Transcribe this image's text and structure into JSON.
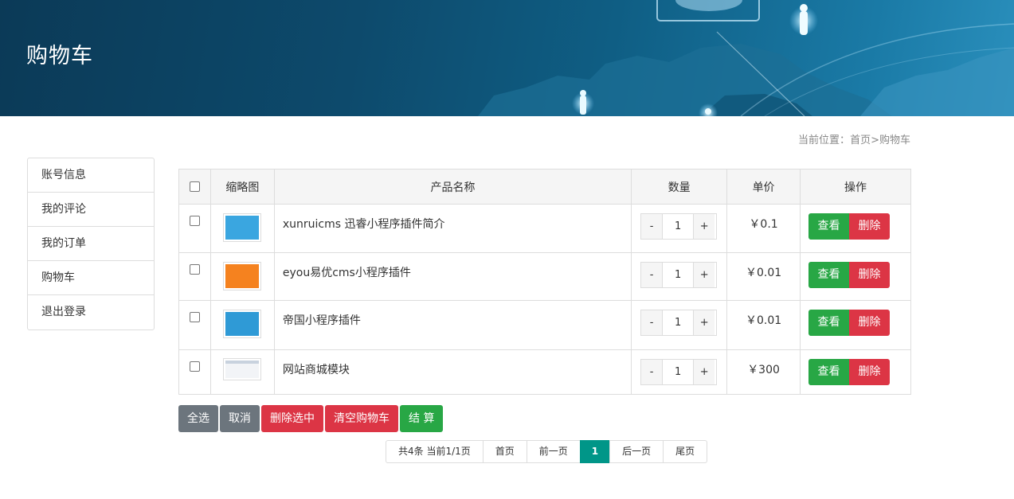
{
  "header": {
    "title": "购物车"
  },
  "breadcrumb": {
    "prefix": "当前位置：",
    "home": "首页",
    "separator": ">",
    "current": "购物车"
  },
  "sidebar": {
    "items": [
      {
        "label": "账号信息"
      },
      {
        "label": "我的评论"
      },
      {
        "label": "我的订单"
      },
      {
        "label": "购物车"
      },
      {
        "label": "退出登录"
      }
    ]
  },
  "table": {
    "headers": {
      "thumb": "缩略图",
      "name": "产品名称",
      "qty": "数量",
      "price": "单价",
      "op": "操作"
    },
    "rows": [
      {
        "name": "xunruicms 迅睿小程序插件简介",
        "qty": "1",
        "price": "￥0.1",
        "thumb_color": "#3aa6e0"
      },
      {
        "name": "eyou易优cms小程序插件",
        "qty": "1",
        "price": "￥0.01",
        "thumb_color": "#f5821f"
      },
      {
        "name": "帝国小程序插件",
        "qty": "1",
        "price": "￥0.01",
        "thumb_color": "#2f9ad6"
      },
      {
        "name": "网站商城模块",
        "qty": "1",
        "price": "￥300",
        "thumb_color": "#f2f4f7"
      }
    ],
    "qty_minus": "-",
    "qty_plus": "+",
    "view_label": "查看",
    "delete_label": "删除"
  },
  "actions": {
    "select_all": "全选",
    "cancel": "取消",
    "delete_selected": "删除选中",
    "clear_cart": "清空购物车",
    "checkout": "结 算"
  },
  "pagination": {
    "info": "共4条 当前1/1页",
    "first": "首页",
    "prev": "前一页",
    "current": "1",
    "next": "后一页",
    "last": "尾页"
  },
  "colors": {
    "primary_green": "#28a745",
    "danger_red": "#dc3545",
    "gray": "#6c757d",
    "pager_active": "#009688"
  }
}
